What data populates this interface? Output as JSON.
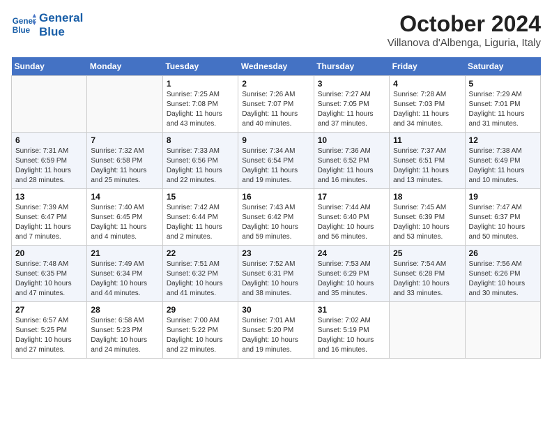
{
  "header": {
    "logo_line1": "General",
    "logo_line2": "Blue",
    "month": "October 2024",
    "location": "Villanova d'Albenga, Liguria, Italy"
  },
  "weekdays": [
    "Sunday",
    "Monday",
    "Tuesday",
    "Wednesday",
    "Thursday",
    "Friday",
    "Saturday"
  ],
  "weeks": [
    [
      {
        "day": "",
        "info": ""
      },
      {
        "day": "",
        "info": ""
      },
      {
        "day": "1",
        "info": "Sunrise: 7:25 AM\nSunset: 7:08 PM\nDaylight: 11 hours and 43 minutes."
      },
      {
        "day": "2",
        "info": "Sunrise: 7:26 AM\nSunset: 7:07 PM\nDaylight: 11 hours and 40 minutes."
      },
      {
        "day": "3",
        "info": "Sunrise: 7:27 AM\nSunset: 7:05 PM\nDaylight: 11 hours and 37 minutes."
      },
      {
        "day": "4",
        "info": "Sunrise: 7:28 AM\nSunset: 7:03 PM\nDaylight: 11 hours and 34 minutes."
      },
      {
        "day": "5",
        "info": "Sunrise: 7:29 AM\nSunset: 7:01 PM\nDaylight: 11 hours and 31 minutes."
      }
    ],
    [
      {
        "day": "6",
        "info": "Sunrise: 7:31 AM\nSunset: 6:59 PM\nDaylight: 11 hours and 28 minutes."
      },
      {
        "day": "7",
        "info": "Sunrise: 7:32 AM\nSunset: 6:58 PM\nDaylight: 11 hours and 25 minutes."
      },
      {
        "day": "8",
        "info": "Sunrise: 7:33 AM\nSunset: 6:56 PM\nDaylight: 11 hours and 22 minutes."
      },
      {
        "day": "9",
        "info": "Sunrise: 7:34 AM\nSunset: 6:54 PM\nDaylight: 11 hours and 19 minutes."
      },
      {
        "day": "10",
        "info": "Sunrise: 7:36 AM\nSunset: 6:52 PM\nDaylight: 11 hours and 16 minutes."
      },
      {
        "day": "11",
        "info": "Sunrise: 7:37 AM\nSunset: 6:51 PM\nDaylight: 11 hours and 13 minutes."
      },
      {
        "day": "12",
        "info": "Sunrise: 7:38 AM\nSunset: 6:49 PM\nDaylight: 11 hours and 10 minutes."
      }
    ],
    [
      {
        "day": "13",
        "info": "Sunrise: 7:39 AM\nSunset: 6:47 PM\nDaylight: 11 hours and 7 minutes."
      },
      {
        "day": "14",
        "info": "Sunrise: 7:40 AM\nSunset: 6:45 PM\nDaylight: 11 hours and 4 minutes."
      },
      {
        "day": "15",
        "info": "Sunrise: 7:42 AM\nSunset: 6:44 PM\nDaylight: 11 hours and 2 minutes."
      },
      {
        "day": "16",
        "info": "Sunrise: 7:43 AM\nSunset: 6:42 PM\nDaylight: 10 hours and 59 minutes."
      },
      {
        "day": "17",
        "info": "Sunrise: 7:44 AM\nSunset: 6:40 PM\nDaylight: 10 hours and 56 minutes."
      },
      {
        "day": "18",
        "info": "Sunrise: 7:45 AM\nSunset: 6:39 PM\nDaylight: 10 hours and 53 minutes."
      },
      {
        "day": "19",
        "info": "Sunrise: 7:47 AM\nSunset: 6:37 PM\nDaylight: 10 hours and 50 minutes."
      }
    ],
    [
      {
        "day": "20",
        "info": "Sunrise: 7:48 AM\nSunset: 6:35 PM\nDaylight: 10 hours and 47 minutes."
      },
      {
        "day": "21",
        "info": "Sunrise: 7:49 AM\nSunset: 6:34 PM\nDaylight: 10 hours and 44 minutes."
      },
      {
        "day": "22",
        "info": "Sunrise: 7:51 AM\nSunset: 6:32 PM\nDaylight: 10 hours and 41 minutes."
      },
      {
        "day": "23",
        "info": "Sunrise: 7:52 AM\nSunset: 6:31 PM\nDaylight: 10 hours and 38 minutes."
      },
      {
        "day": "24",
        "info": "Sunrise: 7:53 AM\nSunset: 6:29 PM\nDaylight: 10 hours and 35 minutes."
      },
      {
        "day": "25",
        "info": "Sunrise: 7:54 AM\nSunset: 6:28 PM\nDaylight: 10 hours and 33 minutes."
      },
      {
        "day": "26",
        "info": "Sunrise: 7:56 AM\nSunset: 6:26 PM\nDaylight: 10 hours and 30 minutes."
      }
    ],
    [
      {
        "day": "27",
        "info": "Sunrise: 6:57 AM\nSunset: 5:25 PM\nDaylight: 10 hours and 27 minutes."
      },
      {
        "day": "28",
        "info": "Sunrise: 6:58 AM\nSunset: 5:23 PM\nDaylight: 10 hours and 24 minutes."
      },
      {
        "day": "29",
        "info": "Sunrise: 7:00 AM\nSunset: 5:22 PM\nDaylight: 10 hours and 22 minutes."
      },
      {
        "day": "30",
        "info": "Sunrise: 7:01 AM\nSunset: 5:20 PM\nDaylight: 10 hours and 19 minutes."
      },
      {
        "day": "31",
        "info": "Sunrise: 7:02 AM\nSunset: 5:19 PM\nDaylight: 10 hours and 16 minutes."
      },
      {
        "day": "",
        "info": ""
      },
      {
        "day": "",
        "info": ""
      }
    ]
  ]
}
